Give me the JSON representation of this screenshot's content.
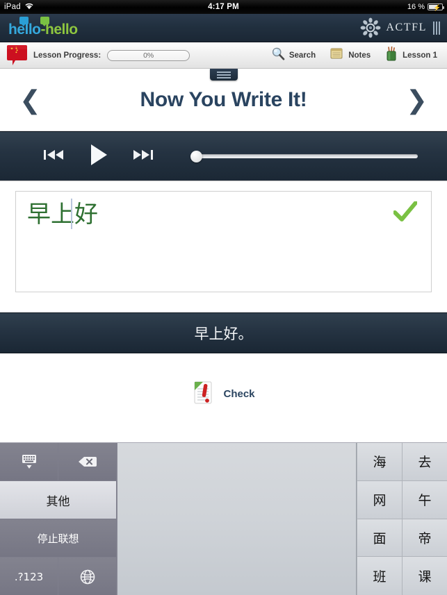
{
  "status_bar": {
    "device": "iPad",
    "wifi_icon": "wifi-icon",
    "time": "4:17 PM",
    "battery_percent": "16 %",
    "battery_icon": "battery-charging-icon"
  },
  "top_nav": {
    "logo_part1": "hello",
    "logo_sep": "-",
    "logo_part2": "hello",
    "brand_name": "ACTFL",
    "brand_icon": "rosette-icon",
    "menu_bars_icon": "three-bars-icon"
  },
  "toolbar": {
    "flag_icon": "china-flag-bubble-icon",
    "progress_label": "Lesson Progress:",
    "progress_value": "0%",
    "progress_percent": 0,
    "items": [
      {
        "label": "Search",
        "icon": "magnifier-icon"
      },
      {
        "label": "Notes",
        "icon": "notepad-icon"
      },
      {
        "label": "Lesson 1",
        "icon": "pencil-cup-icon"
      }
    ]
  },
  "title_bar": {
    "drawer_handle_icon": "drawer-handle-icon",
    "prev_icon": "chevron-left-icon",
    "title": "Now You Write It!",
    "next_icon": "chevron-right-icon"
  },
  "player": {
    "prev_icon": "skip-back-icon",
    "play_icon": "play-icon",
    "next_icon": "skip-forward-icon",
    "seek_position_percent": 0
  },
  "exercise": {
    "typed_answer": "早上好",
    "answer_status_icon": "green-check-icon",
    "target_sentence": "早上好。",
    "check_button_label": "Check",
    "check_button_icon": "check-document-icon"
  },
  "keyboard": {
    "hide_key_icon": "hide-keyboard-icon",
    "backspace_key_icon": "backspace-icon",
    "other_key_label": "其他",
    "stop_predict_key_label": "停止联想",
    "numeric_key_label": ".?123",
    "globe_key_icon": "globe-icon",
    "handwriting_area": "handwriting-canvas",
    "candidates": [
      [
        "海",
        "去"
      ],
      [
        "网",
        "午"
      ],
      [
        "面",
        "帝"
      ],
      [
        "班",
        "课"
      ]
    ]
  },
  "colors": {
    "accent_navy": "#2a4460",
    "dark_bar": "#253342",
    "answer_green": "#2e7031",
    "check_green": "#7ac143",
    "logo_blue": "#35a8dd",
    "logo_green": "#8ec63f"
  }
}
